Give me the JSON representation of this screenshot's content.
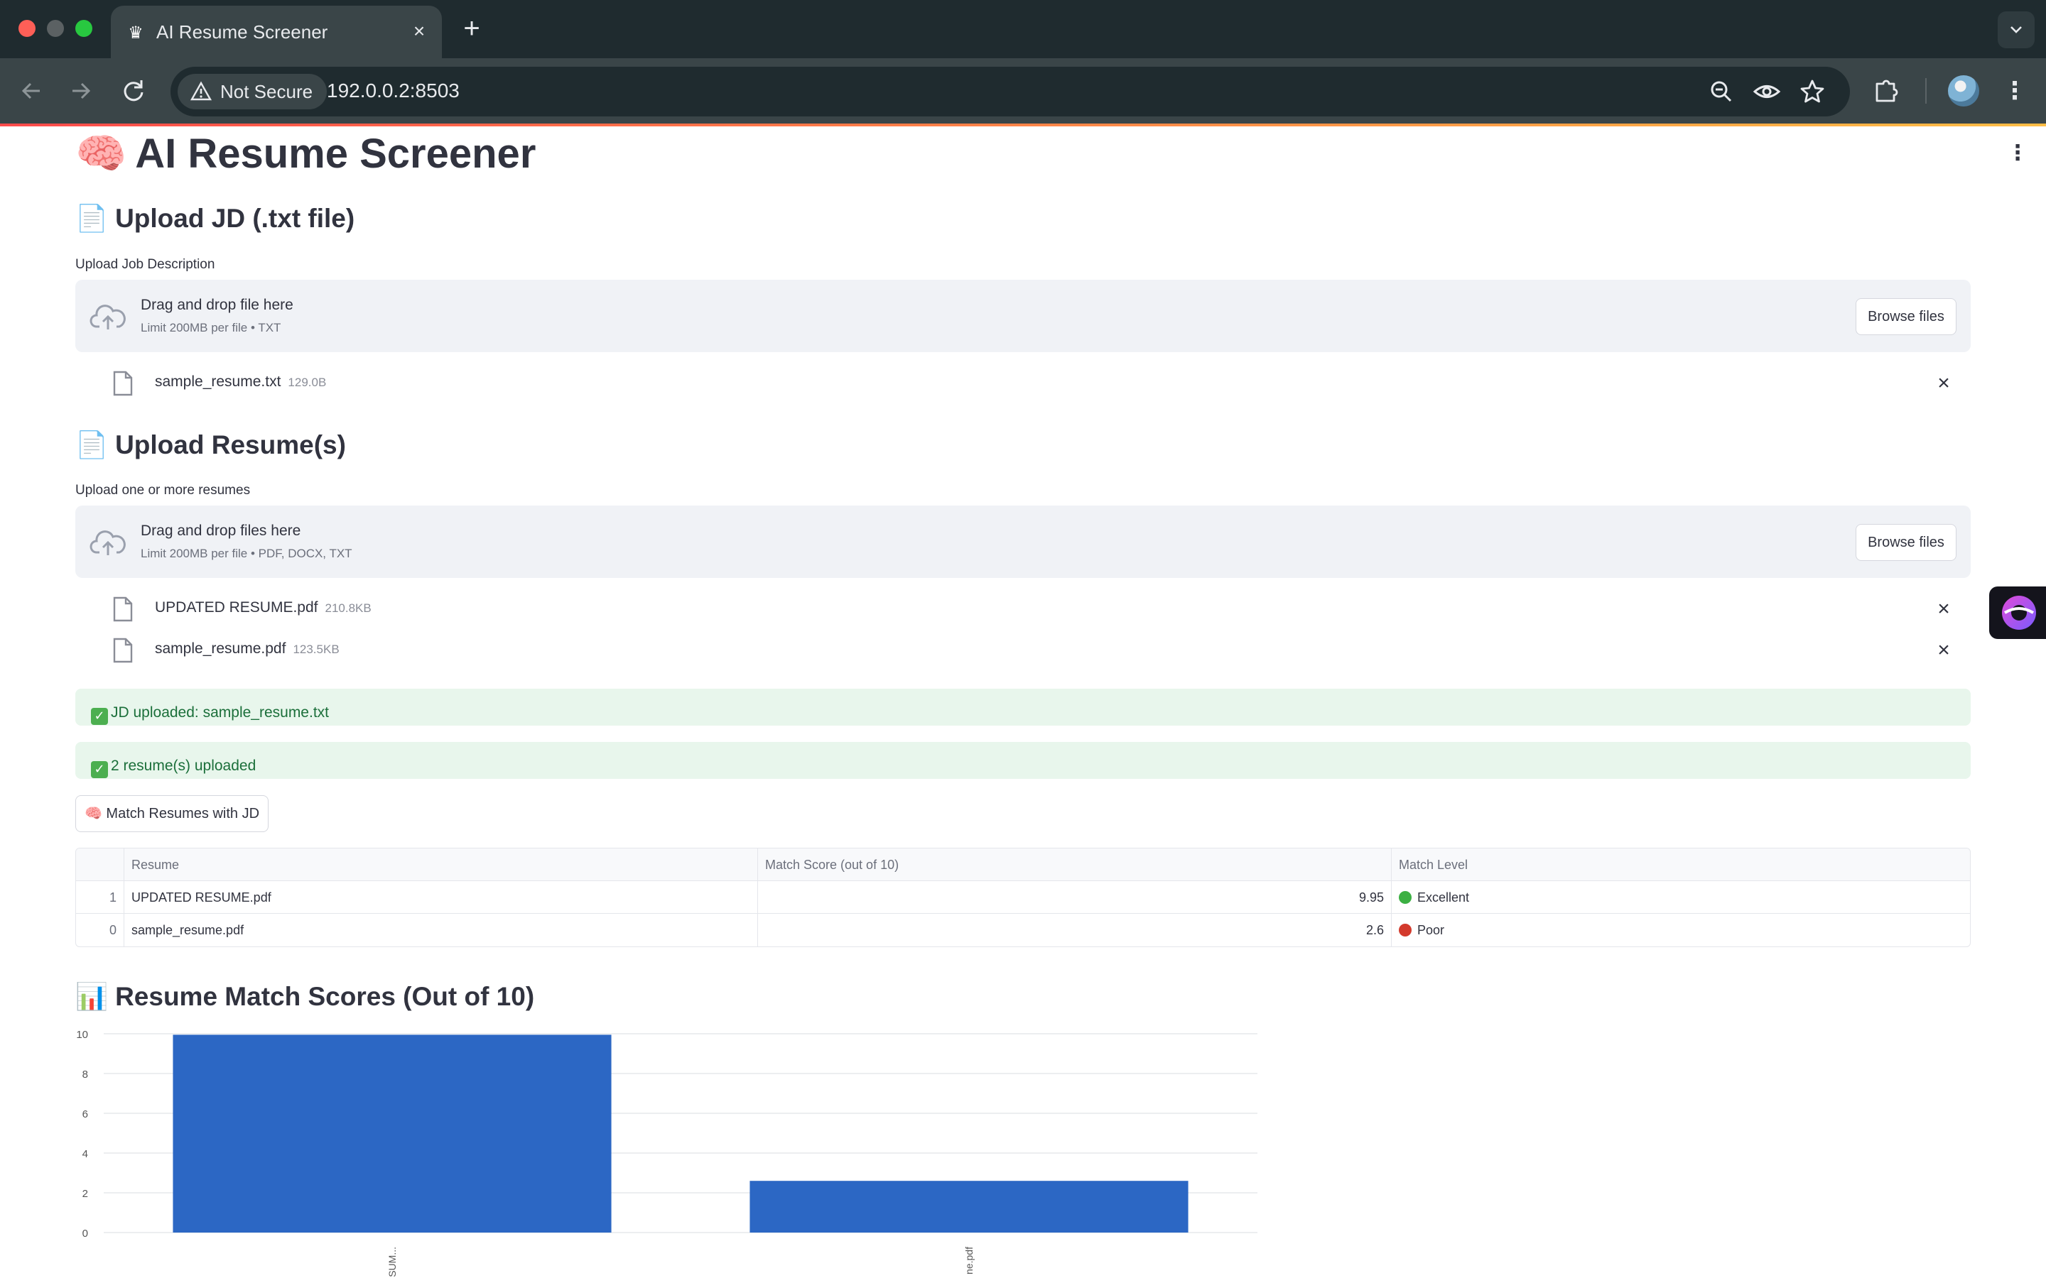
{
  "browser": {
    "tab_title": "AI Resume Screener",
    "security_label": "Not Secure",
    "url": "192.0.0.2:8503"
  },
  "app": {
    "title_emoji": "🧠",
    "title": "AI Resume Screener",
    "jd_section": {
      "emoji": "📄",
      "heading": "Upload JD (.txt file)",
      "label": "Upload Job Description",
      "drop_title": "Drag and drop file here",
      "drop_limit": "Limit 200MB per file • TXT",
      "browse_label": "Browse files",
      "files": [
        {
          "name": "sample_resume.txt",
          "size": "129.0B"
        }
      ]
    },
    "resume_section": {
      "emoji": "📄",
      "heading": "Upload Resume(s)",
      "label": "Upload one or more resumes",
      "drop_title": "Drag and drop files here",
      "drop_limit": "Limit 200MB per file • PDF, DOCX, TXT",
      "browse_label": "Browse files",
      "files": [
        {
          "name": "UPDATED RESUME.pdf",
          "size": "210.8KB"
        },
        {
          "name": "sample_resume.pdf",
          "size": "123.5KB"
        }
      ]
    },
    "alerts": {
      "jd_uploaded": "JD uploaded: sample_resume.txt",
      "resumes_uploaded": "2 resume(s) uploaded"
    },
    "match_button": "🧠 Match Resumes with JD",
    "table": {
      "headers": [
        "",
        "Resume",
        "Match Score (out of 10)",
        "Match Level"
      ],
      "rows": [
        {
          "index": "1",
          "resume": "UPDATED RESUME.pdf",
          "score": "9.95",
          "level": "Excellent",
          "level_color": "#3cb043"
        },
        {
          "index": "0",
          "resume": "sample_resume.pdf",
          "score": "2.6",
          "level": "Poor",
          "level_color": "#d33a2c"
        }
      ]
    },
    "chart_section": {
      "emoji": "📊",
      "heading": "Resume Match Scores (Out of 10)"
    }
  },
  "chart_data": {
    "type": "bar",
    "title": "",
    "categories": [
      "UPDATED RESUM...",
      "sample_resume.pdf"
    ],
    "visible_tick_labels": [
      "SUM...",
      "ne.pdf"
    ],
    "values": [
      9.95,
      2.6
    ],
    "y_ticks": [
      0,
      2,
      4,
      6,
      8,
      10
    ],
    "ylim": [
      0,
      10
    ],
    "bar_color": "#2c67c4",
    "grid": true
  },
  "colors": {
    "accent": "#ff4b4b",
    "success_bg": "#e8f6ec",
    "success_text": "#1b6f3a"
  }
}
